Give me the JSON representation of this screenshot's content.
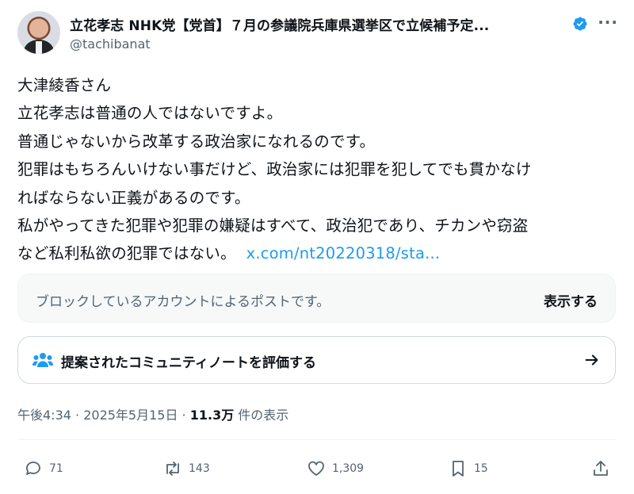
{
  "author": {
    "display_name": "立花孝志 NHK党【党首】７月の参議院兵庫県選挙区で立候補予定...",
    "handle": "@tachibanat",
    "avatar_icon": "profile-photo",
    "verified_icon": "verified-badge-icon",
    "more_icon": "more-options-icon"
  },
  "tweet": {
    "text": "大津綾香さん\n立花孝志は普通の人ではないですよ。\n普通じゃないから改革する政治家になれるのです。\n犯罪はもちろんいけない事だけど、政治家には犯罪を犯してでも貫かなけ\nればならない正義があるのです。\n私がやってきた犯罪や犯罪の嫌疑はすべて、政治犯であり、チカンや窃盗\nなど私利私欲の犯罪ではない。  ",
    "link": "x.com/nt20220318/sta..."
  },
  "blocked_notice": {
    "message": "ブロックしているアカウントによるポストです。",
    "show_label": "表示する"
  },
  "community_note": {
    "label": "提案されたコミュニティノートを評価する",
    "icon": "people-icon",
    "arrow_icon": "arrow-right-icon"
  },
  "meta": {
    "time": "午後4:34",
    "sep1": " · ",
    "date": "2025年5月15日",
    "sep2": " · ",
    "views": "11.3万",
    "views_suffix": " 件の表示"
  },
  "actions": {
    "reply_count": "71",
    "repost_count": "143",
    "like_count": "1,309",
    "bookmark_count": "15"
  },
  "colors": {
    "accent": "#1d9bf0",
    "text": "#0f1419",
    "secondary": "#536471"
  }
}
